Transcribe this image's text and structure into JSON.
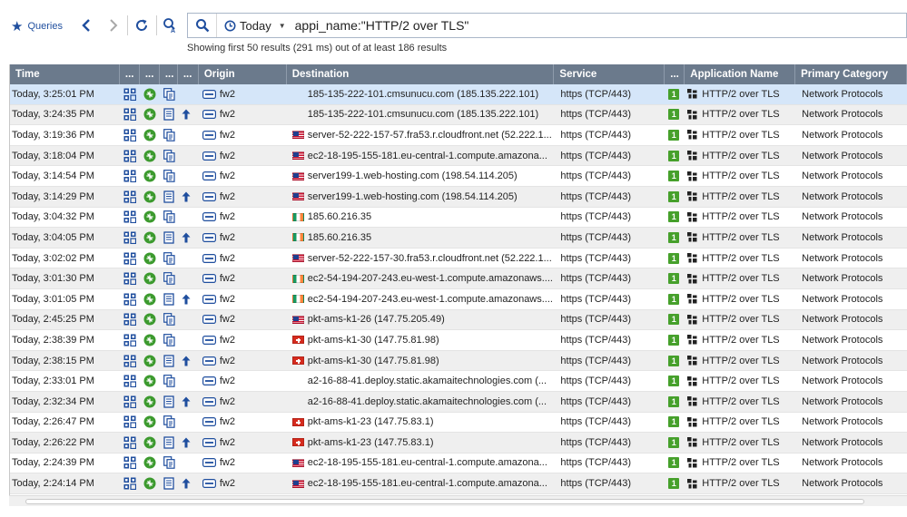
{
  "toolbar": {
    "queries_label": "Queries",
    "back_icon": "back-arrow-icon",
    "forward_icon": "forward-arrow-icon",
    "refresh_icon": "refresh-icon",
    "search_settings_icon": "search-settings-icon",
    "search_icon": "search-icon",
    "date_label": "Today",
    "query": "appi_name:\"HTTP/2 over TLS\"",
    "status": "Showing first 50 results (291 ms) out of at least 186 results"
  },
  "columns": {
    "time": "Time",
    "e1": "...",
    "e2": "...",
    "e3": "...",
    "e4": "...",
    "origin": "Origin",
    "destination": "Destination",
    "service": "Service",
    "e5": "...",
    "app": "Application Name",
    "category": "Primary Category"
  },
  "colors": {
    "header_bg": "#6b7a8c",
    "selected_row": "#d5e6f9",
    "accent": "#1f4e9e",
    "risk_badge": "#46a02b"
  },
  "rows": [
    {
      "time": "Today, 3:25:01 PM",
      "upload": false,
      "origin": "fw2",
      "flag": "none",
      "destination": "185-135-222-101.cmsunucu.com (185.135.222.101)",
      "service": "https (TCP/443)",
      "risk": "1",
      "app": "HTTP/2 over TLS",
      "category": "Network Protocols"
    },
    {
      "time": "Today, 3:24:35 PM",
      "upload": true,
      "origin": "fw2",
      "flag": "none",
      "destination": "185-135-222-101.cmsunucu.com (185.135.222.101)",
      "service": "https (TCP/443)",
      "risk": "1",
      "app": "HTTP/2 over TLS",
      "category": "Network Protocols"
    },
    {
      "time": "Today, 3:19:36 PM",
      "upload": false,
      "origin": "fw2",
      "flag": "us",
      "destination": "server-52-222-157-57.fra53.r.cloudfront.net (52.222.1...",
      "service": "https (TCP/443)",
      "risk": "1",
      "app": "HTTP/2 over TLS",
      "category": "Network Protocols"
    },
    {
      "time": "Today, 3:18:04 PM",
      "upload": false,
      "origin": "fw2",
      "flag": "us",
      "destination": "ec2-18-195-155-181.eu-central-1.compute.amazona...",
      "service": "https (TCP/443)",
      "risk": "1",
      "app": "HTTP/2 over TLS",
      "category": "Network Protocols"
    },
    {
      "time": "Today, 3:14:54 PM",
      "upload": false,
      "origin": "fw2",
      "flag": "us",
      "destination": "server199-1.web-hosting.com (198.54.114.205)",
      "service": "https (TCP/443)",
      "risk": "1",
      "app": "HTTP/2 over TLS",
      "category": "Network Protocols"
    },
    {
      "time": "Today, 3:14:29 PM",
      "upload": true,
      "origin": "fw2",
      "flag": "us",
      "destination": "server199-1.web-hosting.com (198.54.114.205)",
      "service": "https (TCP/443)",
      "risk": "1",
      "app": "HTTP/2 over TLS",
      "category": "Network Protocols"
    },
    {
      "time": "Today, 3:04:32 PM",
      "upload": false,
      "origin": "fw2",
      "flag": "ie",
      "destination": "185.60.216.35",
      "service": "https (TCP/443)",
      "risk": "1",
      "app": "HTTP/2 over TLS",
      "category": "Network Protocols"
    },
    {
      "time": "Today, 3:04:05 PM",
      "upload": true,
      "origin": "fw2",
      "flag": "ie",
      "destination": "185.60.216.35",
      "service": "https (TCP/443)",
      "risk": "1",
      "app": "HTTP/2 over TLS",
      "category": "Network Protocols"
    },
    {
      "time": "Today, 3:02:02 PM",
      "upload": false,
      "origin": "fw2",
      "flag": "us",
      "destination": "server-52-222-157-30.fra53.r.cloudfront.net (52.222.1...",
      "service": "https (TCP/443)",
      "risk": "1",
      "app": "HTTP/2 over TLS",
      "category": "Network Protocols"
    },
    {
      "time": "Today, 3:01:30 PM",
      "upload": false,
      "origin": "fw2",
      "flag": "ie",
      "destination": "ec2-54-194-207-243.eu-west-1.compute.amazonaws....",
      "service": "https (TCP/443)",
      "risk": "1",
      "app": "HTTP/2 over TLS",
      "category": "Network Protocols"
    },
    {
      "time": "Today, 3:01:05 PM",
      "upload": true,
      "origin": "fw2",
      "flag": "ie",
      "destination": "ec2-54-194-207-243.eu-west-1.compute.amazonaws....",
      "service": "https (TCP/443)",
      "risk": "1",
      "app": "HTTP/2 over TLS",
      "category": "Network Protocols"
    },
    {
      "time": "Today, 2:45:25 PM",
      "upload": false,
      "origin": "fw2",
      "flag": "us",
      "destination": "pkt-ams-k1-26 (147.75.205.49)",
      "service": "https (TCP/443)",
      "risk": "1",
      "app": "HTTP/2 over TLS",
      "category": "Network Protocols"
    },
    {
      "time": "Today, 2:38:39 PM",
      "upload": false,
      "origin": "fw2",
      "flag": "ch",
      "destination": "pkt-ams-k1-30 (147.75.81.98)",
      "service": "https (TCP/443)",
      "risk": "1",
      "app": "HTTP/2 over TLS",
      "category": "Network Protocols"
    },
    {
      "time": "Today, 2:38:15 PM",
      "upload": true,
      "origin": "fw2",
      "flag": "ch",
      "destination": "pkt-ams-k1-30 (147.75.81.98)",
      "service": "https (TCP/443)",
      "risk": "1",
      "app": "HTTP/2 over TLS",
      "category": "Network Protocols"
    },
    {
      "time": "Today, 2:33:01 PM",
      "upload": false,
      "origin": "fw2",
      "flag": "none",
      "destination": "a2-16-88-41.deploy.static.akamaitechnologies.com (...",
      "service": "https (TCP/443)",
      "risk": "1",
      "app": "HTTP/2 over TLS",
      "category": "Network Protocols"
    },
    {
      "time": "Today, 2:32:34 PM",
      "upload": true,
      "origin": "fw2",
      "flag": "none",
      "destination": "a2-16-88-41.deploy.static.akamaitechnologies.com (...",
      "service": "https (TCP/443)",
      "risk": "1",
      "app": "HTTP/2 over TLS",
      "category": "Network Protocols"
    },
    {
      "time": "Today, 2:26:47 PM",
      "upload": false,
      "origin": "fw2",
      "flag": "ch",
      "destination": "pkt-ams-k1-23 (147.75.83.1)",
      "service": "https (TCP/443)",
      "risk": "1",
      "app": "HTTP/2 over TLS",
      "category": "Network Protocols"
    },
    {
      "time": "Today, 2:26:22 PM",
      "upload": true,
      "origin": "fw2",
      "flag": "ch",
      "destination": "pkt-ams-k1-23 (147.75.83.1)",
      "service": "https (TCP/443)",
      "risk": "1",
      "app": "HTTP/2 over TLS",
      "category": "Network Protocols"
    },
    {
      "time": "Today, 2:24:39 PM",
      "upload": false,
      "origin": "fw2",
      "flag": "us",
      "destination": "ec2-18-195-155-181.eu-central-1.compute.amazona...",
      "service": "https (TCP/443)",
      "risk": "1",
      "app": "HTTP/2 over TLS",
      "category": "Network Protocols"
    },
    {
      "time": "Today, 2:24:14 PM",
      "upload": true,
      "origin": "fw2",
      "flag": "us",
      "destination": "ec2-18-195-155-181.eu-central-1.compute.amazona...",
      "service": "https (TCP/443)",
      "risk": "1",
      "app": "HTTP/2 over TLS",
      "category": "Network Protocols"
    }
  ]
}
